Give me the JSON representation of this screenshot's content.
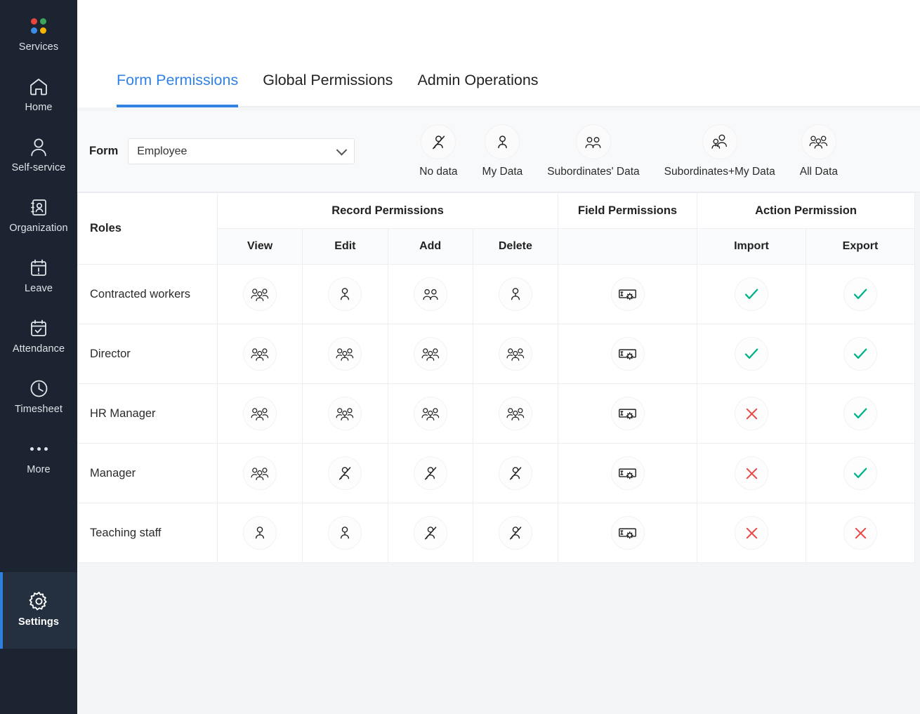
{
  "sidebar": {
    "items": [
      {
        "label": "Services",
        "icon": "services-dots-icon",
        "active": false
      },
      {
        "label": "Home",
        "icon": "home-icon",
        "active": false
      },
      {
        "label": "Self-service",
        "icon": "person-icon",
        "active": false
      },
      {
        "label": "Organization",
        "icon": "organization-badge-icon",
        "active": false
      },
      {
        "label": "Leave",
        "icon": "calendar-alert-icon",
        "active": false
      },
      {
        "label": "Attendance",
        "icon": "calendar-check-icon",
        "active": false
      },
      {
        "label": "Timesheet",
        "icon": "clock-icon",
        "active": false
      },
      {
        "label": "More",
        "icon": "ellipsis-icon",
        "active": false
      },
      {
        "label": "Settings",
        "icon": "gear-icon",
        "active": true
      }
    ],
    "dot_colors": [
      "#e8453c",
      "#3aa757",
      "#3a8ee6",
      "#f4b400"
    ],
    "background": "#1c2431",
    "active_accent": "#2e7fe0"
  },
  "tabs": [
    {
      "label": "Form Permissions",
      "active": true
    },
    {
      "label": "Global Permissions",
      "active": false
    },
    {
      "label": "Admin Operations",
      "active": false
    }
  ],
  "form_selector": {
    "label": "Form",
    "value": "Employee",
    "placeholder": "Employee",
    "chevron": "chevron-down-icon"
  },
  "legend": [
    {
      "label": "No data",
      "icon": "person-slashed-icon"
    },
    {
      "label": "My Data",
      "icon": "single-person-icon"
    },
    {
      "label": "Subordinates' Data",
      "icon": "two-people-icon"
    },
    {
      "label": "Subordinates+My Data",
      "icon": "two-people-offset-icon"
    },
    {
      "label": "All Data",
      "icon": "three-people-icon"
    }
  ],
  "table": {
    "roles_header": "Roles",
    "groups": [
      {
        "label": "Record Permissions",
        "colspan": 4
      },
      {
        "label": "Field Permissions",
        "colspan": 1
      },
      {
        "label": "Action Permission",
        "colspan": 2
      }
    ],
    "subheaders": [
      "View",
      "Edit",
      "Add",
      "Delete",
      "",
      "Import",
      "Export"
    ],
    "rows": [
      {
        "role": "Contracted workers",
        "view": "three-people-icon",
        "edit": "single-person-icon",
        "add": "two-people-icon",
        "delete": "single-person-icon",
        "field": "field-settings-icon",
        "import": "check-icon",
        "export": "check-icon"
      },
      {
        "role": "Director",
        "view": "three-people-icon",
        "edit": "three-people-icon",
        "add": "three-people-icon",
        "delete": "three-people-icon",
        "field": "field-settings-icon",
        "import": "check-icon",
        "export": "check-icon"
      },
      {
        "role": "HR Manager",
        "view": "three-people-icon",
        "edit": "three-people-icon",
        "add": "three-people-icon",
        "delete": "three-people-icon",
        "field": "field-settings-icon",
        "import": "cross-icon",
        "export": "check-icon"
      },
      {
        "role": "Manager",
        "view": "three-people-icon",
        "edit": "person-slashed-icon",
        "add": "person-slashed-icon",
        "delete": "person-slashed-icon",
        "field": "field-settings-icon",
        "import": "cross-icon",
        "export": "check-icon"
      },
      {
        "role": "Teaching staff",
        "view": "single-person-icon",
        "edit": "single-person-icon",
        "add": "person-slashed-icon",
        "delete": "person-slashed-icon",
        "field": "field-settings-icon",
        "import": "cross-icon",
        "export": "cross-icon"
      }
    ]
  },
  "colors": {
    "accent_blue": "#3082e4",
    "check_green": "#00b289",
    "cross_red": "#ea4b4b",
    "sidebar_bg": "#1c2431",
    "page_bg": "#f4f5f7",
    "border": "#eceef1"
  }
}
